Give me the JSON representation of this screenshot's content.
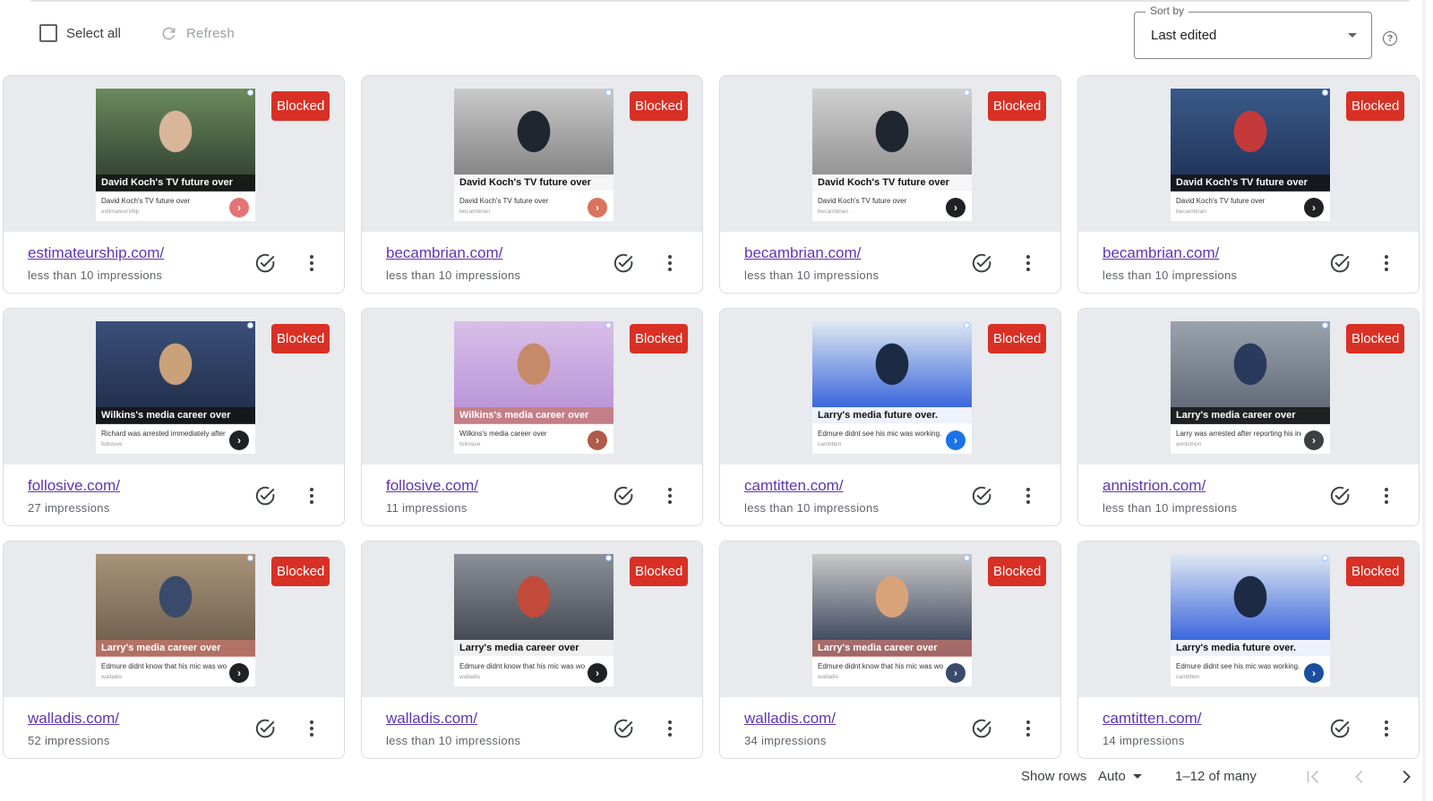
{
  "toolbar": {
    "select_all_label": "Select all",
    "refresh_label": "Refresh",
    "sort_legend": "Sort by",
    "sort_value": "Last edited",
    "help_icon": "help-circle-icon"
  },
  "status_badge_label": "Blocked",
  "colors": {
    "blocked": "#d93025",
    "link": "#5e35b1",
    "card_border": "#dadce0",
    "preview_bg": "#e8eaed"
  },
  "cards": [
    {
      "domain": "estimateurship.com/",
      "impressions": "less than 10 impressions",
      "ad_headline": "David Koch's TV future over",
      "ad_description": "David Koch's TV future over",
      "ad_domain": "estimateurship",
      "headline_style": "dark",
      "arrow_color": "#e57373",
      "img": [
        "#2b3a2e",
        "#6b8a5d",
        "#d9b59a"
      ]
    },
    {
      "domain": "becambrian.com/",
      "impressions": "less than 10 impressions",
      "ad_headline": "David Koch's TV future over",
      "ad_description": "David Koch's TV future over",
      "ad_domain": "becambrian",
      "headline_style": "light",
      "arrow_color": "#d9735c",
      "img": [
        "#7a7a7a",
        "#c9c9c9",
        "#1f2630"
      ]
    },
    {
      "domain": "becambrian.com/",
      "impressions": "less than 10 impressions",
      "ad_headline": "David Koch's TV future over",
      "ad_description": "David Koch's TV future over",
      "ad_domain": "becambrian",
      "headline_style": "light",
      "arrow_color": "#202124",
      "img": [
        "#8a8a8a",
        "#d0d0d0",
        "#1f2630"
      ]
    },
    {
      "domain": "becambrian.com/",
      "impressions": "less than 10 impressions",
      "ad_headline": "David Koch's TV future over",
      "ad_description": "David Koch's TV future over",
      "ad_domain": "becambrian",
      "headline_style": "dark",
      "arrow_color": "#202124",
      "img": [
        "#1c2f55",
        "#3a5a8a",
        "#c43a3a"
      ]
    },
    {
      "domain": "follosive.com/",
      "impressions": "27 impressions",
      "ad_headline": "Wilkins's media career over",
      "ad_description": "Richard was arrested immediately after reporting his income.",
      "ad_domain": "follosive",
      "headline_style": "dark",
      "arrow_color": "#202124",
      "img": [
        "#1e2b44",
        "#3a4f7a",
        "#c9a27a"
      ]
    },
    {
      "domain": "follosive.com/",
      "impressions": "11 impressions",
      "ad_headline": "Wilkins's media career over",
      "ad_description": "Wilkins's media career over",
      "ad_domain": "follosive",
      "headline_style": "faded",
      "arrow_color": "#b05a4a",
      "img": [
        "#b68ed6",
        "#d8bfe8",
        "#c58a6a"
      ]
    },
    {
      "domain": "camtitten.com/",
      "impressions": "less than 10 impressions",
      "ad_headline": "Larry's media future over.",
      "ad_description": "Edmure didnt see his mic was working.",
      "ad_domain": "camtitten",
      "headline_style": "light",
      "arrow_color": "#1a73e8",
      "img": [
        "#1d4fd8",
        "#dfe8f2",
        "#1c2a44"
      ]
    },
    {
      "domain": "annistrion.com/",
      "impressions": "less than 10 impressions",
      "ad_headline": "Larry's media career over",
      "ad_description": "Larry was arrested after reporting his income",
      "ad_domain": "annistrion",
      "headline_style": "dark",
      "arrow_color": "#3c4043",
      "img": [
        "#5a6270",
        "#9aa3ad",
        "#2a3a5c"
      ]
    },
    {
      "domain": "walladis.com/",
      "impressions": "52 impressions",
      "ad_headline": "Larry's media career over",
      "ad_description": "Edmure didnt know that his mic was working!",
      "ad_domain": "walladis",
      "headline_style": "faded",
      "arrow_color": "#202124",
      "img": [
        "#6a5a48",
        "#a8937a",
        "#3a4a6a"
      ]
    },
    {
      "domain": "walladis.com/",
      "impressions": "less than 10 impressions",
      "ad_headline": "Larry's media career over",
      "ad_description": "Edmure didnt know that his mic was working!",
      "ad_domain": "walladis",
      "headline_style": "light",
      "arrow_color": "#202124",
      "img": [
        "#3a3f48",
        "#8a8f98",
        "#c24a3a"
      ]
    },
    {
      "domain": "walladis.com/",
      "impressions": "34 impressions",
      "ad_headline": "Larry's media career over",
      "ad_description": "Edmure didnt know that his mic was working!",
      "ad_domain": "walladis",
      "headline_style": "faded",
      "arrow_color": "#3a4a6a",
      "img": [
        "#2a3550",
        "#c9c9c9",
        "#d9a37a"
      ]
    },
    {
      "domain": "camtitten.com/",
      "impressions": "14 impressions",
      "ad_headline": "Larry's media future over.",
      "ad_description": "Edmure didnt see his mic was working.",
      "ad_domain": "camtitten",
      "headline_style": "light",
      "arrow_color": "#1a4fa0",
      "img": [
        "#1d4fd8",
        "#dfe8f2",
        "#1c2a44"
      ]
    }
  ],
  "pagination": {
    "show_rows_label": "Show rows",
    "rows_value": "Auto",
    "range": "1–12 of many"
  }
}
